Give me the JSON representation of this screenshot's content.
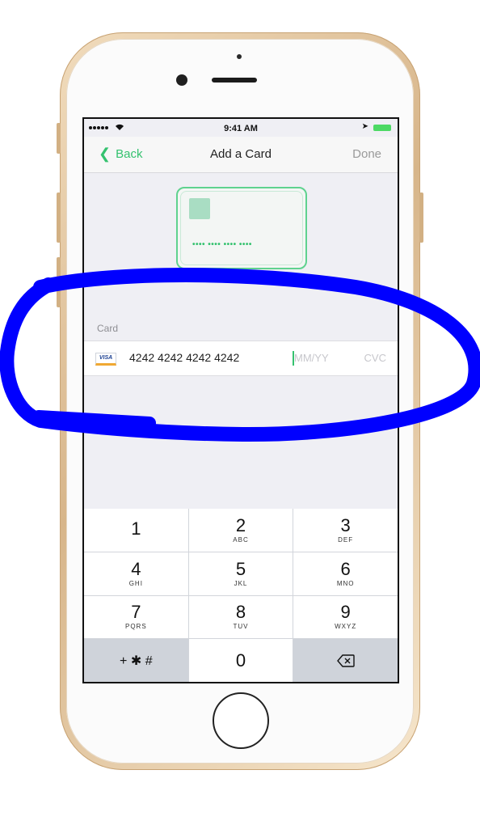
{
  "status_bar": {
    "time": "9:41 AM"
  },
  "nav": {
    "back_label": "Back",
    "title": "Add a Card",
    "done_label": "Done"
  },
  "card_illustration": {
    "dots": "•••• •••• •••• ••••"
  },
  "form": {
    "section_label": "Card",
    "card_brand": "VISA",
    "card_number": "4242 4242 4242 4242",
    "expiry_placeholder": "MM/YY",
    "cvc_placeholder": "CVC"
  },
  "keypad": {
    "keys": [
      {
        "digit": "1",
        "letters": ""
      },
      {
        "digit": "2",
        "letters": "ABC"
      },
      {
        "digit": "3",
        "letters": "DEF"
      },
      {
        "digit": "4",
        "letters": "GHI"
      },
      {
        "digit": "5",
        "letters": "JKL"
      },
      {
        "digit": "6",
        "letters": "MNO"
      },
      {
        "digit": "7",
        "letters": "PQRS"
      },
      {
        "digit": "8",
        "letters": "TUV"
      },
      {
        "digit": "9",
        "letters": "WXYZ"
      }
    ],
    "symbols_label": "+ ✱ #",
    "zero": "0",
    "delete_icon": "delete-backspace-icon"
  },
  "colors": {
    "accent": "#35c26f",
    "annotation": "#0000ff"
  }
}
